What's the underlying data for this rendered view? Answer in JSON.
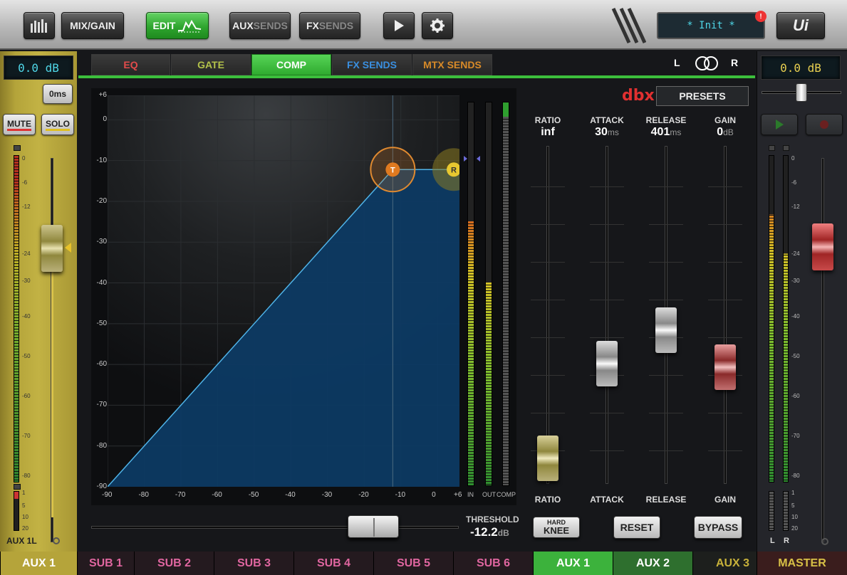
{
  "toolbar": {
    "meters_icon": "bar-meters-icon",
    "mix_gain": "MIX/GAIN",
    "edit": "EDIT",
    "aux_a": "AUX",
    "aux_b": "SENDS",
    "fx_a": "FX",
    "fx_b": "SENDS",
    "play_icon": "play-icon",
    "gear_icon": "gear-icon",
    "lcd": "* Init *",
    "alert": "!",
    "logo": "Ui"
  },
  "left": {
    "gain": "0.0 dB",
    "delay": "0ms",
    "mute": "MUTE",
    "solo": "SOLO",
    "scale": [
      "0",
      "-6",
      "-12",
      "-24",
      "-30",
      "-40",
      "-50",
      "-60",
      "-70",
      "-80",
      "1",
      "5",
      "10",
      "20"
    ],
    "name": "AUX 1L",
    "fader_level_db": -24
  },
  "tabs": [
    {
      "label": "EQ",
      "color": "#e34b4b",
      "active": false
    },
    {
      "label": "GATE",
      "color": "#b3c24a",
      "active": false
    },
    {
      "label": "COMP",
      "color": "#ffffff",
      "active": true
    },
    {
      "label": "FX SENDS",
      "color": "#3a8fe0",
      "active": false
    },
    {
      "label": "MTX SENDS",
      "color": "#d88a28",
      "active": false
    }
  ],
  "stereo": {
    "l": "L",
    "r": "R"
  },
  "graph": {
    "y_labels": [
      "+6",
      "0",
      "-10",
      "-20",
      "-30",
      "-40",
      "-50",
      "-60",
      "-70",
      "-80",
      "-90"
    ],
    "x_labels": [
      "-90",
      "-80",
      "-70",
      "-60",
      "-50",
      "-40",
      "-30",
      "-20",
      "-10",
      "0",
      "+6"
    ],
    "threshold_handle": "T",
    "ratio_handle": "R",
    "meter_labels": [
      "IN",
      "OUT",
      "COMP"
    ],
    "threshold_label": "THRESHOLD",
    "threshold_value": "-12.2",
    "threshold_unit": "dB"
  },
  "chart_data": {
    "type": "line",
    "title": "",
    "xlabel": "",
    "ylabel": "",
    "xlim": [
      -90,
      6
    ],
    "ylim": [
      -90,
      6
    ],
    "series": [
      {
        "x": [
          -90,
          -12.2,
          6
        ],
        "y": [
          -90,
          -12.2,
          -12.2
        ]
      }
    ],
    "meter_fill": {
      "in": 0.69,
      "out": 0.53,
      "comp": 0.0
    }
  },
  "comp": {
    "brand": "dbx",
    "presets": "PRESETS",
    "params": [
      {
        "name": "RATIO",
        "value": "inf",
        "unit": "",
        "level": 0.08
      },
      {
        "name": "ATTACK",
        "value": "30",
        "unit": "ms",
        "level": 0.36
      },
      {
        "name": "RELEASE",
        "value": "401",
        "unit": "ms",
        "level": 0.46
      },
      {
        "name": "GAIN",
        "value": "0",
        "unit": "dB",
        "level": 0.35
      }
    ],
    "hard": "HARD",
    "knee": "KNEE",
    "reset": "RESET",
    "bypass": "BYPASS"
  },
  "right": {
    "gain": "0.0 dB",
    "scale": [
      "0",
      "-6",
      "-12",
      "-24",
      "-30",
      "-40",
      "-50",
      "-60",
      "-70",
      "-80",
      "1",
      "5",
      "10",
      "20"
    ],
    "meter_l": "L",
    "meter_r": "R"
  },
  "bottom_tabs": [
    {
      "label": "AUX 1",
      "color": "#ffffff",
      "bg": "#b5a43a"
    },
    {
      "label": "SUB 1",
      "color": "#e066a0",
      "bg": "#241a1f"
    },
    {
      "label": "SUB 2",
      "color": "#e066a0",
      "bg": "#241a1f"
    },
    {
      "label": "SUB 3",
      "color": "#e066a0",
      "bg": "#241a1f"
    },
    {
      "label": "SUB 4",
      "color": "#e066a0",
      "bg": "#241a1f"
    },
    {
      "label": "SUB 5",
      "color": "#e066a0",
      "bg": "#241a1f"
    },
    {
      "label": "SUB 6",
      "color": "#e066a0",
      "bg": "#241a1f"
    },
    {
      "label": "AUX 1",
      "color": "#ffffff",
      "bg": "#3cb23c"
    },
    {
      "label": "AUX 2",
      "color": "#ffffff",
      "bg": "#2e6f2e"
    },
    {
      "label": "AUX 3",
      "color": "#c8b23a",
      "bg": "#1d1f1d"
    },
    {
      "label": "MASTER",
      "color": "#d8c046",
      "bg": "#3a1d1d"
    }
  ]
}
